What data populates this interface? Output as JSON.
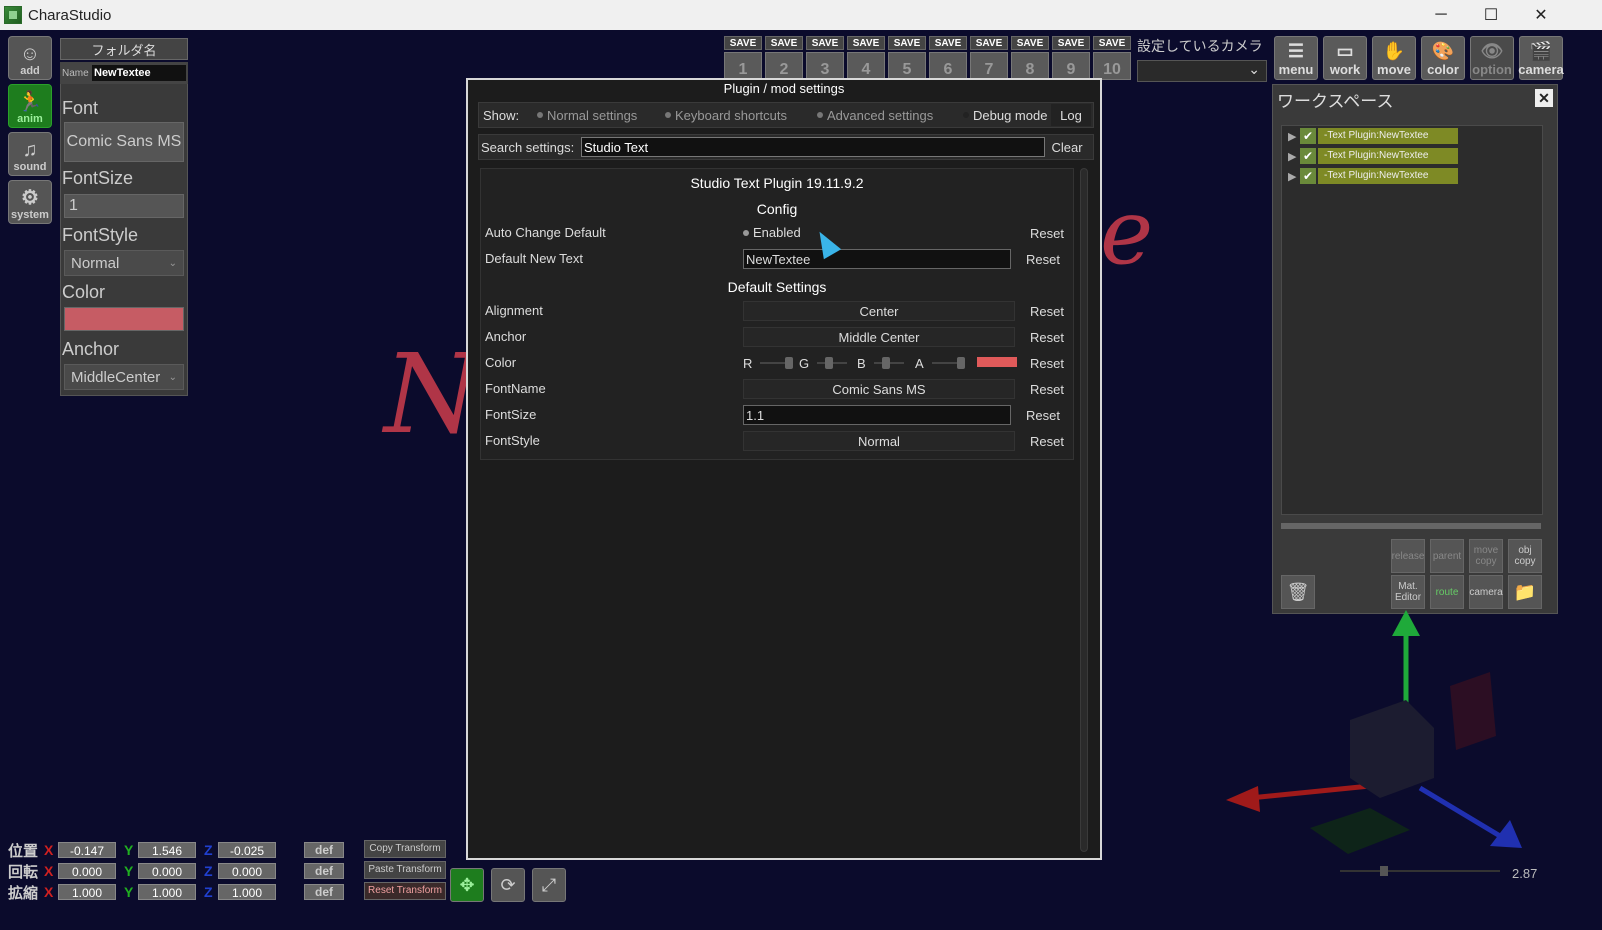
{
  "window": {
    "title": "CharaStudio",
    "minimize": "─",
    "maximize": "☐",
    "close": "✕"
  },
  "left_buttons": [
    {
      "label": "add",
      "glyph": "☺"
    },
    {
      "label": "anim",
      "glyph": "🏃"
    },
    {
      "label": "sound",
      "glyph": "♫"
    },
    {
      "label": "system",
      "glyph": "⚙"
    }
  ],
  "text_panel": {
    "folder_button": "フォルダ名",
    "name_label": "Name",
    "name_value": "NewTextee",
    "font_label": "Font",
    "font_value": "Comic Sans MS",
    "fontsize_label": "FontSize",
    "fontsize_value": "1",
    "fontstyle_label": "FontStyle",
    "fontstyle_value": "Normal",
    "color_label": "Color",
    "color_value": "#c65c64",
    "anchor_label": "Anchor",
    "anchor_value": "MiddleCenter"
  },
  "save_slots": [
    {
      "label": "SAVE",
      "num": "1"
    },
    {
      "label": "SAVE",
      "num": "2"
    },
    {
      "label": "SAVE",
      "num": "3"
    },
    {
      "label": "SAVE",
      "num": "4"
    },
    {
      "label": "SAVE",
      "num": "5"
    },
    {
      "label": "SAVE",
      "num": "6"
    },
    {
      "label": "SAVE",
      "num": "7"
    },
    {
      "label": "SAVE",
      "num": "8"
    },
    {
      "label": "SAVE",
      "num": "9"
    },
    {
      "label": "SAVE",
      "num": "10"
    }
  ],
  "camera_setting": {
    "label": "設定しているカメラ",
    "chevron": "⌄"
  },
  "top_icons": [
    {
      "label": "menu",
      "glyph": "☰"
    },
    {
      "label": "work",
      "glyph": "▭"
    },
    {
      "label": "move",
      "glyph": "✋"
    },
    {
      "label": "color",
      "glyph": "🎨"
    },
    {
      "label": "option",
      "glyph": "👁"
    },
    {
      "label": "camera",
      "glyph": "🎬"
    }
  ],
  "workspace": {
    "title": "ワークスペース",
    "close": "✕",
    "items": [
      {
        "label": "-Text Plugin:NewTextee"
      },
      {
        "label": "-Text Plugin:NewTextee"
      },
      {
        "label": "-Text Plugin:NewTextee"
      }
    ],
    "buttons": [
      {
        "label": "release"
      },
      {
        "label": "parent"
      },
      {
        "label": "move copy"
      },
      {
        "label": "obj copy"
      },
      {
        "label": "Mat. Editor"
      },
      {
        "label": "route"
      },
      {
        "label": "camera"
      },
      {
        "label": ""
      }
    ]
  },
  "scene_text": {
    "left": "N",
    "right": "e"
  },
  "dialog": {
    "title": "Plugin / mod settings",
    "show_label": "Show:",
    "toggles": {
      "normal": "Normal settings",
      "keyboard": "Keyboard shortcuts",
      "advanced": "Advanced settings",
      "debug": "Debug mode"
    },
    "log_button": "Log",
    "search_label": "Search settings:",
    "search_value": "Studio Text",
    "clear_button": "Clear",
    "plugin_title": "Studio Text Plugin 19.11.9.2",
    "config_header": "Config",
    "defaults_header": "Default Settings",
    "reset": "Reset",
    "settings": {
      "auto_change_default": {
        "name": "Auto Change Default",
        "value": "Enabled"
      },
      "default_new_text": {
        "name": "Default New Text",
        "value": "NewTextee"
      },
      "alignment": {
        "name": "Alignment",
        "value": "Center"
      },
      "anchor": {
        "name": "Anchor",
        "value": "Middle Center"
      },
      "color": {
        "name": "Color",
        "channels": [
          "R",
          "G",
          "B",
          "A"
        ],
        "swatch": "#e05a5a"
      },
      "fontname": {
        "name": "FontName",
        "value": "Comic Sans MS"
      },
      "fontsize": {
        "name": "FontSize",
        "value": "1.1"
      },
      "fontstyle": {
        "name": "FontStyle",
        "value": "Normal"
      }
    }
  },
  "transform": {
    "rows": [
      {
        "label": "位置",
        "x": "-0.147",
        "y": "1.546",
        "z": "-0.025"
      },
      {
        "label": "回転",
        "x": "0.000",
        "y": "0.000",
        "z": "0.000"
      },
      {
        "label": "拡縮",
        "x": "1.000",
        "y": "1.000",
        "z": "1.000"
      }
    ],
    "axis_x": "X",
    "axis_y": "Y",
    "axis_z": "Z",
    "def": "def",
    "copy": "Copy Transform",
    "paste": "Paste Transform",
    "reset": "Reset Transform"
  },
  "zoom_value": "2.87",
  "colors": {
    "accent_green": "#1e7d1e",
    "x_axis": "#d02020",
    "y_axis": "#20b020",
    "z_axis": "#2040d0"
  }
}
